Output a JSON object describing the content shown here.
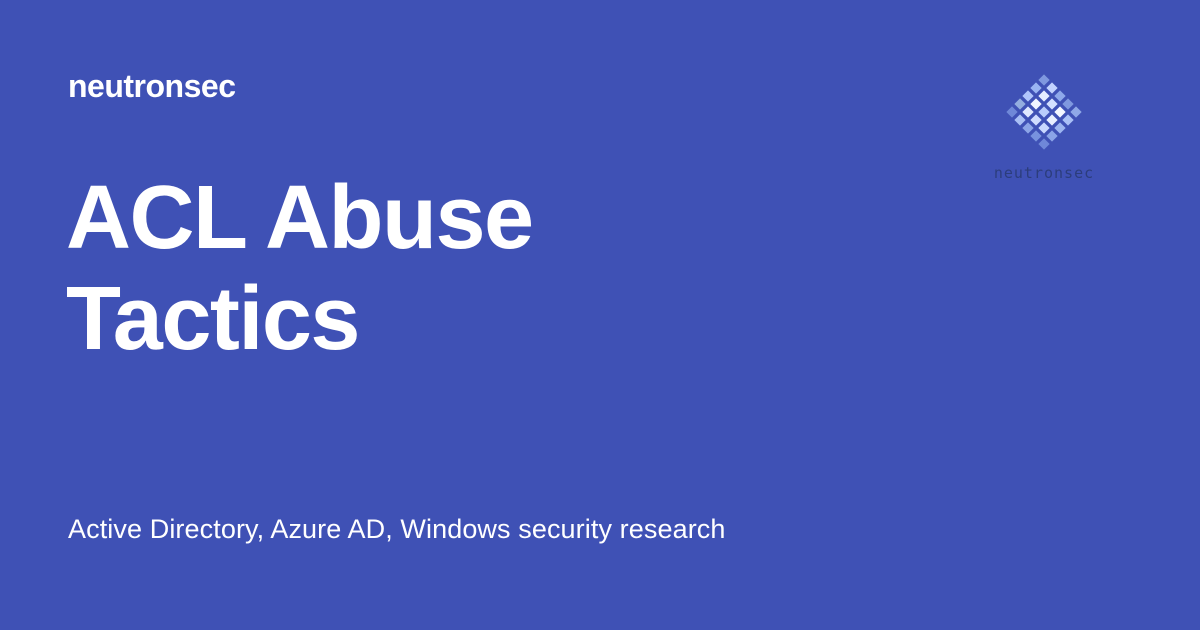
{
  "social_card": {
    "site_name": "neutronsec",
    "title_line_1": "ACL Abuse",
    "title_line_2": "Tactics",
    "description": "Active Directory, Azure AD, Windows security research",
    "background_color": "#3f51b5",
    "text_color": "#ffffff"
  },
  "logo": {
    "name": "neutronsec-logo-icon",
    "wordmark": "neutronsec",
    "colors": {
      "light": "#d7e2ff",
      "mid": "#9fb8f5",
      "deep": "#6c84d9",
      "text": "#2c3d7c"
    }
  }
}
